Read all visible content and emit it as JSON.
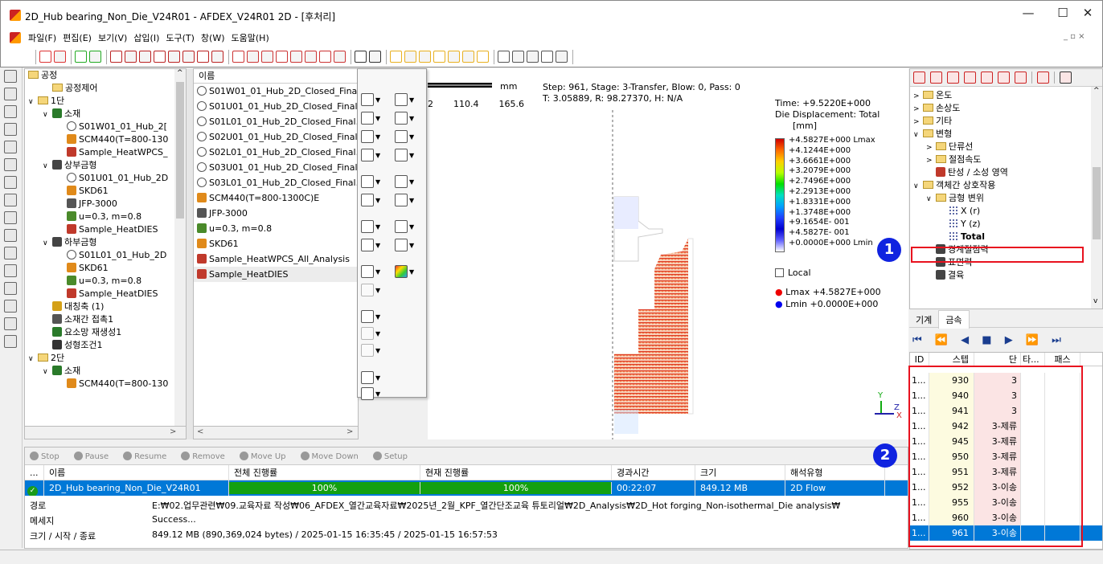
{
  "window": {
    "title": "2D_Hub bearing_Non_Die_V24R01 - AFDEX_V24R01 2D - [후처리]",
    "min": "—",
    "max": "☐",
    "close": "✕"
  },
  "menu": [
    "파일(F)",
    "편집(E)",
    "보기(V)",
    "삽입(I)",
    "도구(T)",
    "창(W)",
    "도움말(H)"
  ],
  "mdi_controls": "_ ▫ ×",
  "tree": {
    "header": "공정",
    "rows": [
      {
        "indent": 1,
        "text": "공정제어",
        "icon": "folder"
      },
      {
        "indent": 0,
        "exp": "∨",
        "text": "1단",
        "icon": "folder"
      },
      {
        "indent": 1,
        "exp": "∨",
        "text": "소재",
        "icon": "material"
      },
      {
        "indent": 2,
        "text": "S01W01_01_Hub_2[",
        "icon": "mesh"
      },
      {
        "indent": 2,
        "text": "SCM440(T=800-130",
        "icon": "steel"
      },
      {
        "indent": 2,
        "text": "Sample_HeatWPCS_",
        "icon": "heat"
      },
      {
        "indent": 1,
        "exp": "∨",
        "text": "상부금형",
        "icon": "die"
      },
      {
        "indent": 2,
        "text": "S01U01_01_Hub_2D",
        "icon": "mesh"
      },
      {
        "indent": 2,
        "text": "SKD61",
        "icon": "steel"
      },
      {
        "indent": 2,
        "text": "JFP-3000",
        "icon": "press"
      },
      {
        "indent": 2,
        "text": "u=0.3, m=0.8",
        "icon": "friction"
      },
      {
        "indent": 2,
        "text": "Sample_HeatDIES",
        "icon": "heat"
      },
      {
        "indent": 1,
        "exp": "∨",
        "text": "하부금형",
        "icon": "die"
      },
      {
        "indent": 2,
        "text": "S01L01_01_Hub_2D",
        "icon": "mesh"
      },
      {
        "indent": 2,
        "text": "SKD61",
        "icon": "steel"
      },
      {
        "indent": 2,
        "text": "u=0.3, m=0.8",
        "icon": "friction"
      },
      {
        "indent": 2,
        "text": "Sample_HeatDIES",
        "icon": "heat"
      },
      {
        "indent": 1,
        "text": "대칭축 (1)",
        "icon": "axis"
      },
      {
        "indent": 1,
        "text": "소재간 접촉1",
        "icon": "contact"
      },
      {
        "indent": 1,
        "text": "요소망 재생성1",
        "icon": "remesh"
      },
      {
        "indent": 1,
        "text": "성형조건1",
        "icon": "cond"
      },
      {
        "indent": 0,
        "exp": "∨",
        "text": "2단",
        "icon": "folder"
      },
      {
        "indent": 1,
        "exp": "∨",
        "text": "소재",
        "icon": "material"
      },
      {
        "indent": 2,
        "text": "SCM440(T=800-130",
        "icon": "steel"
      }
    ]
  },
  "list": {
    "header": "이름",
    "rows": [
      {
        "text": "S01W01_01_Hub_2D_Closed_Fina",
        "icon": "mesh"
      },
      {
        "text": "S01U01_01_Hub_2D_Closed_Final",
        "icon": "mesh"
      },
      {
        "text": "S01L01_01_Hub_2D_Closed_Final.",
        "icon": "mesh"
      },
      {
        "text": "S02U01_01_Hub_2D_Closed_Final.",
        "icon": "mesh"
      },
      {
        "text": "S02L01_01_Hub_2D_Closed_Final.",
        "icon": "mesh"
      },
      {
        "text": "S03U01_01_Hub_2D_Closed_Final",
        "icon": "mesh"
      },
      {
        "text": "S03L01_01_Hub_2D_Closed_Final.",
        "icon": "mesh"
      },
      {
        "text": "SCM440(T=800-1300C)E",
        "icon": "steel"
      },
      {
        "text": "JFP-3000",
        "icon": "press"
      },
      {
        "text": "u=0.3, m=0.8",
        "icon": "friction"
      },
      {
        "text": "SKD61",
        "icon": "steel"
      },
      {
        "text": "Sample_HeatWPCS_All_Analysis",
        "icon": "heat"
      },
      {
        "text": "Sample_HeatDIES",
        "icon": "heat"
      }
    ]
  },
  "viewport": {
    "scale_unit": "mm",
    "scale_ticks": [
      "2",
      "110.4",
      "165.6"
    ],
    "step_line1": "Step: 961, Stage: 3-Transfer, Blow: 0, Pass: 0",
    "step_line2": "T: 3.05889, R: 98.27370, H: N/A",
    "legend_time": "Time: +9.5220E+000",
    "legend_var": "Die Displacement: Total",
    "legend_unit": "[mm]",
    "legend_values": [
      "+4.5827E+000 Lmax",
      "+4.1244E+000",
      "+3.6661E+000",
      "+3.2079E+000",
      "+2.7496E+000",
      "+2.2913E+000",
      "+1.8331E+000",
      "+1.3748E+000",
      "+9.1654E- 001",
      "+4.5827E- 001",
      "+0.0000E+000 Lmin"
    ],
    "local_label": "Local",
    "lmax": "Lmax  +4.5827E+000",
    "lmin": "Lmin  +0.0000E+000",
    "axis_y": "Y",
    "axis_z": "Z",
    "axis_x": "X"
  },
  "job": {
    "buttons": [
      "Stop",
      "Pause",
      "Resume",
      "Remove",
      "Move Up",
      "Move Down",
      "Setup"
    ],
    "columns": [
      "...",
      "이름",
      "전체 진행률",
      "현재 진행률",
      "경과시간",
      "크기",
      "해석유형"
    ],
    "row": {
      "name": "2D_Hub bearing_Non_Die_V24R01",
      "total": "100%",
      "current": "100%",
      "elapsed": "00:22:07",
      "size": "849.12 MB",
      "type": "2D Flow",
      "total_progress": 1.0,
      "current_progress": 1.0
    },
    "info": [
      {
        "label": "경로",
        "value": "E:₩02.업무관련₩09.교육자료 작성₩06_AFDEX_열간교육자료₩2025년_2월_KPF_열간단조교육 튜토리얼₩2D_Analysis₩2D_Hot forging_Non-isothermal_Die analysis₩"
      },
      {
        "label": "메세지",
        "value": "Success..."
      },
      {
        "label": "크기 / 시작 / 종료",
        "value": "849.12 MB (890,369,024 bytes) / 2025-01-15 16:35:45 / 2025-01-15 16:57:53"
      }
    ]
  },
  "rtree": {
    "rows": [
      {
        "indent": 0,
        "exp": ">",
        "text": "온도",
        "icon": "folder"
      },
      {
        "indent": 0,
        "exp": ">",
        "text": "손상도",
        "icon": "folder"
      },
      {
        "indent": 0,
        "exp": ">",
        "text": "기타",
        "icon": "folder"
      },
      {
        "indent": 0,
        "exp": "∨",
        "text": "변형",
        "icon": "folder"
      },
      {
        "indent": 1,
        "exp": ">",
        "text": "단류선",
        "icon": "folder"
      },
      {
        "indent": 1,
        "exp": ">",
        "text": "절점속도",
        "icon": "folder"
      },
      {
        "indent": 1,
        "text": "탄성 / 소성 영역",
        "icon": "region"
      },
      {
        "indent": 0,
        "exp": "∨",
        "text": "객체간 상호작용",
        "icon": "folder"
      },
      {
        "indent": 1,
        "exp": "∨",
        "text": "금형 변위",
        "icon": "folder"
      },
      {
        "indent": 2,
        "text": "X (r)",
        "icon": "dots"
      },
      {
        "indent": 2,
        "text": "Y (z)",
        "icon": "dots"
      },
      {
        "indent": 2,
        "text": "Total",
        "icon": "dots",
        "bold": true
      },
      {
        "indent": 1,
        "text": "경계절점력",
        "icon": "force"
      },
      {
        "indent": 1,
        "text": "표면력",
        "icon": "force"
      },
      {
        "indent": 1,
        "text": "결육",
        "icon": "force"
      }
    ]
  },
  "tabs": [
    "기계",
    "금속"
  ],
  "nav": "⏮ ⏪ ◀ ■ ▶ ⏩ ⏭",
  "steps": {
    "columns": [
      "ID",
      "스텝",
      "단",
      "타...",
      "패스"
    ],
    "rows": [
      {
        "id": "1...",
        "step": "930",
        "stage": "3"
      },
      {
        "id": "1...",
        "step": "940",
        "stage": "3"
      },
      {
        "id": "1...",
        "step": "941",
        "stage": "3"
      },
      {
        "id": "1...",
        "step": "942",
        "stage": "3-제류"
      },
      {
        "id": "1...",
        "step": "945",
        "stage": "3-제류"
      },
      {
        "id": "1...",
        "step": "950",
        "stage": "3-제류"
      },
      {
        "id": "1...",
        "step": "951",
        "stage": "3-제류"
      },
      {
        "id": "1...",
        "step": "952",
        "stage": "3-이송"
      },
      {
        "id": "1...",
        "step": "955",
        "stage": "3-이송"
      },
      {
        "id": "1...",
        "step": "960",
        "stage": "3-이송"
      },
      {
        "id": "1...",
        "step": "961",
        "stage": "3-이송",
        "selected": true
      }
    ]
  },
  "badges": [
    "1",
    "2"
  ],
  "colors": {
    "accent": "#0078d7",
    "highlight_red": "#e8121f",
    "badge_blue": "#1023e0",
    "progress_green": "#13a010"
  }
}
